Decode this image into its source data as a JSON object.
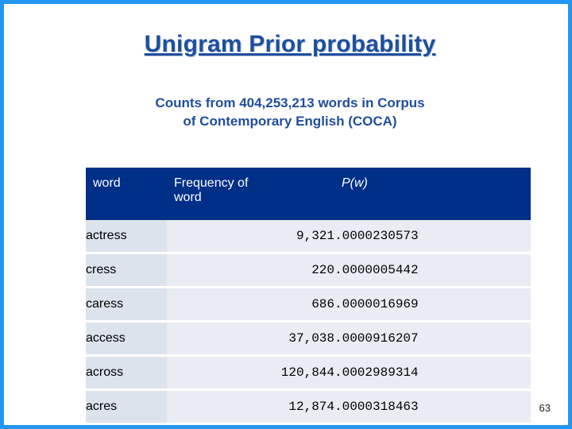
{
  "slide": {
    "title": "Unigram Prior probability",
    "subtitle_line1": "Counts from 404,253,213 words in Corpus",
    "subtitle_line2": "of Contemporary English (COCA)",
    "page_number": "63",
    "accent_color": "#2196f3",
    "header_color": "#002f87",
    "title_color": "#1f4e9c"
  },
  "table": {
    "headers": {
      "word": "word",
      "frequency_line1": "Frequency of",
      "frequency_line2": "word",
      "probability": "P(w)"
    },
    "rows": [
      {
        "word": "actress",
        "frequency": "9,321",
        "probability": ".0000230573"
      },
      {
        "word": "cress",
        "frequency": "220",
        "probability": ".0000005442"
      },
      {
        "word": "caress",
        "frequency": "686",
        "probability": ".0000016969"
      },
      {
        "word": "access",
        "frequency": "37,038",
        "probability": ".0000916207"
      },
      {
        "word": "across",
        "frequency": "120,844",
        "probability": ".0002989314"
      },
      {
        "word": "acres",
        "frequency": "12,874",
        "probability": ".0000318463"
      }
    ]
  }
}
